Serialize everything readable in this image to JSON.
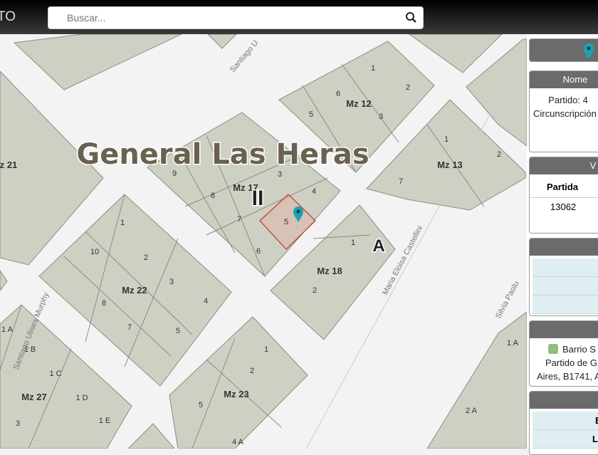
{
  "header": {
    "brand": "TO",
    "search_placeholder": "Buscar..."
  },
  "map": {
    "locality": "General Las Heras",
    "sector": "II",
    "sector_letter": "A",
    "streets": [
      "Santiago U",
      "Santiago Ulises Murphy",
      "Maria Eloisa Castellini",
      "Silvia Paolu"
    ],
    "blocks": {
      "mz12": "Mz 12",
      "mz13": "Mz 13",
      "mz17": "Mz 17",
      "mz18": "Mz 18",
      "mz21": "z 21",
      "mz22": "Mz 22",
      "mz23": "Mz 23",
      "mz27": "Mz 27"
    },
    "selected_parcel": "5",
    "marker_color": "#1aa3b8",
    "selection_color": "#c0392b"
  },
  "panel": {
    "nomenclatura": {
      "title": "Nome",
      "lines": [
        "Partido: 4",
        "Circunscripción"
      ]
    },
    "valuacion": {
      "title": "V",
      "col": "Partida",
      "value": "13062"
    },
    "address": {
      "lines": [
        "Barrio S",
        "Partido de G",
        "Aires, B1741, A"
      ]
    },
    "last": {
      "rows": [
        "E",
        "La"
      ]
    }
  }
}
